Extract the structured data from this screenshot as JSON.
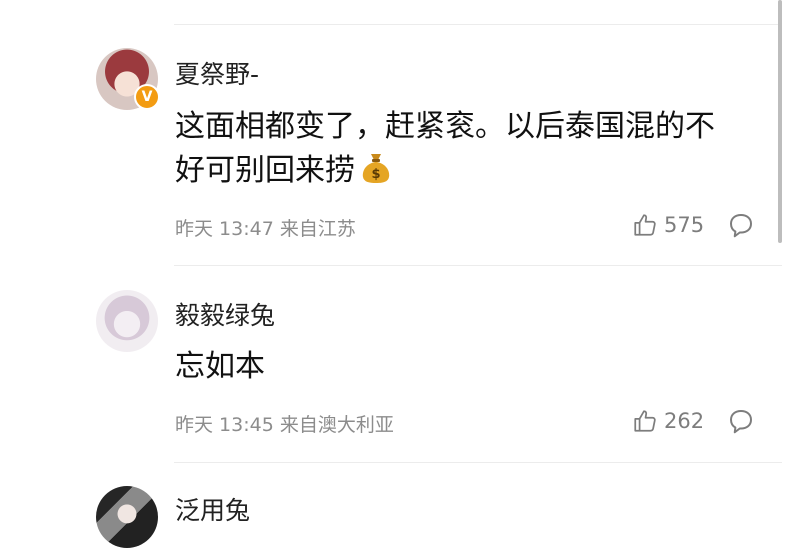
{
  "comments": [
    {
      "username": "夏祭野-",
      "verified_badge": "V",
      "text_line1": "这面相都变了，赶紧衮。以后泰国混的不",
      "text_line2": "好可别回来捞",
      "emoji": "money-bag-icon",
      "time": "昨天 13:47",
      "location": "来自江苏",
      "likes": "575"
    },
    {
      "username": "毅毅绿兔",
      "text_line1": "忘如本",
      "time": "昨天 13:45",
      "location": "来自澳大利亚",
      "likes": "262"
    },
    {
      "username": "泛用兔"
    }
  ],
  "colors": {
    "badge": "#f39c12",
    "meta": "#8c8c8c",
    "divider": "#ececec"
  }
}
